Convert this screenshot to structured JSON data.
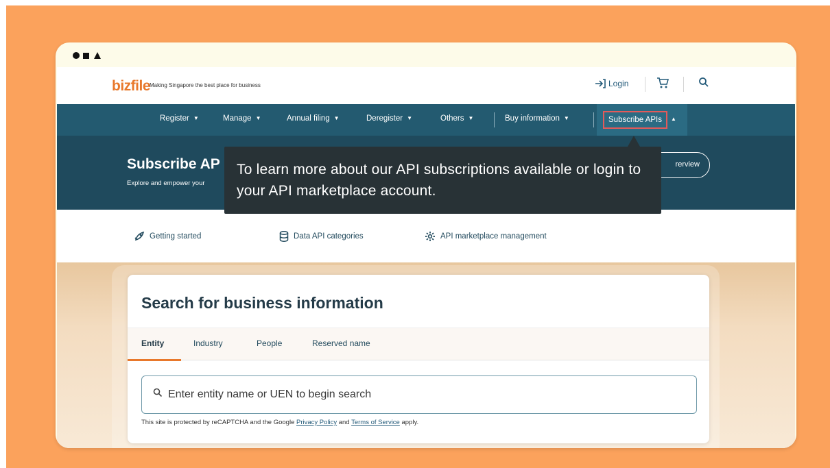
{
  "colors": {
    "slide_bg": "#fba25c",
    "window_bg": "#fdfbe9",
    "nav_bg": "#235a70",
    "banner_bg": "#1f4a5d",
    "accent": "#e8782b",
    "highlight_border": "#e35a5a",
    "tooltip_bg": "#283236"
  },
  "header": {
    "logo": "bizfile",
    "tagline": "Making Singapore the best place for business",
    "login_label": "Login",
    "icons": [
      "login-arrow-icon",
      "cart-icon",
      "search-icon"
    ]
  },
  "nav": {
    "items": [
      {
        "label": "Register"
      },
      {
        "label": "Manage"
      },
      {
        "label": "Annual filing"
      },
      {
        "label": "Deregister"
      },
      {
        "label": "Others"
      },
      {
        "label": "Buy information"
      }
    ],
    "active": "Subscribe APIs"
  },
  "banner": {
    "title": "Subscribe AP",
    "subtitle": "Explore and empower your",
    "overview_btn": "rerview"
  },
  "subnav": {
    "items": [
      {
        "label": "Getting started",
        "icon": "rocket-icon"
      },
      {
        "label": "Data API categories",
        "icon": "database-icon"
      },
      {
        "label": "API marketplace management",
        "icon": "gear-icon"
      }
    ]
  },
  "search": {
    "title": "Search for business information",
    "tabs": [
      {
        "label": "Entity"
      },
      {
        "label": "Industry"
      },
      {
        "label": "People"
      },
      {
        "label": "Reserved name"
      }
    ],
    "active_tab": "Entity",
    "placeholder": "Enter entity name or UEN to begin search",
    "captcha_prefix": "This site is protected by reCAPTCHA and the Google",
    "privacy_link": "Privacy Policy",
    "captcha_and": "and",
    "terms_link": "Terms of Service",
    "captcha_suffix": "apply."
  },
  "tooltip": {
    "text": "To learn more about our API subscriptions available or login to your API marketplace account."
  }
}
